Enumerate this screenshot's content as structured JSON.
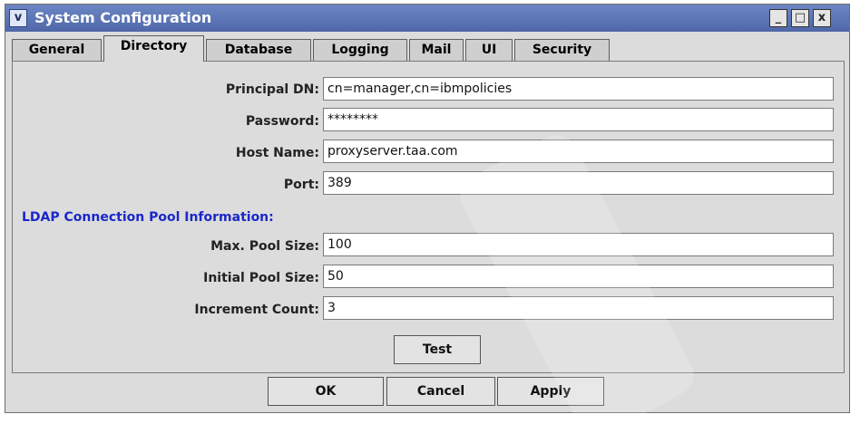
{
  "window": {
    "title": "System Configuration",
    "controls": {
      "menu": "v",
      "minimize": "_",
      "maximize": "□",
      "close": "x"
    }
  },
  "tabs": [
    {
      "label": "General"
    },
    {
      "label": "Directory"
    },
    {
      "label": "Database"
    },
    {
      "label": "Logging"
    },
    {
      "label": "Mail"
    },
    {
      "label": "UI"
    },
    {
      "label": "Security"
    }
  ],
  "form": {
    "principal_dn_label": "Principal DN:",
    "principal_dn_value": "cn=manager,cn=ibmpolicies",
    "password_label": "Password:",
    "password_value": "********",
    "host_name_label": "Host Name:",
    "host_name_value": "proxyserver.taa.com",
    "port_label": "Port:",
    "port_value": "389",
    "pool_section_title": "LDAP Connection Pool Information:",
    "max_pool_label": "Max. Pool Size:",
    "max_pool_value": "100",
    "initial_pool_label": "Initial Pool Size:",
    "initial_pool_value": "50",
    "increment_label": "Increment Count:",
    "increment_value": "3"
  },
  "buttons": {
    "test": "Test",
    "ok": "OK",
    "cancel": "Cancel",
    "apply": "Apply"
  }
}
